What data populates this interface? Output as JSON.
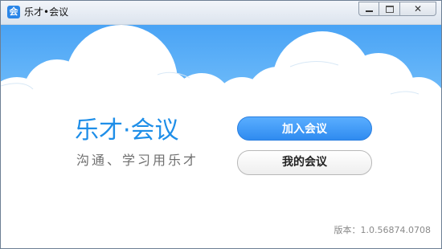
{
  "window": {
    "title": "乐才•会议",
    "close_glyph": "✕"
  },
  "logo": {
    "text": "乐才·会议"
  },
  "slogan": "沟通、学习用乐才",
  "actions": {
    "join_label": "加入会议",
    "mine_label": "我的会议"
  },
  "version": "版本：1.0.56874.0708",
  "colors": {
    "accent": "#2f8bf0",
    "sky_top": "#49a3f5",
    "logo_blue": "#1e8ee8"
  }
}
